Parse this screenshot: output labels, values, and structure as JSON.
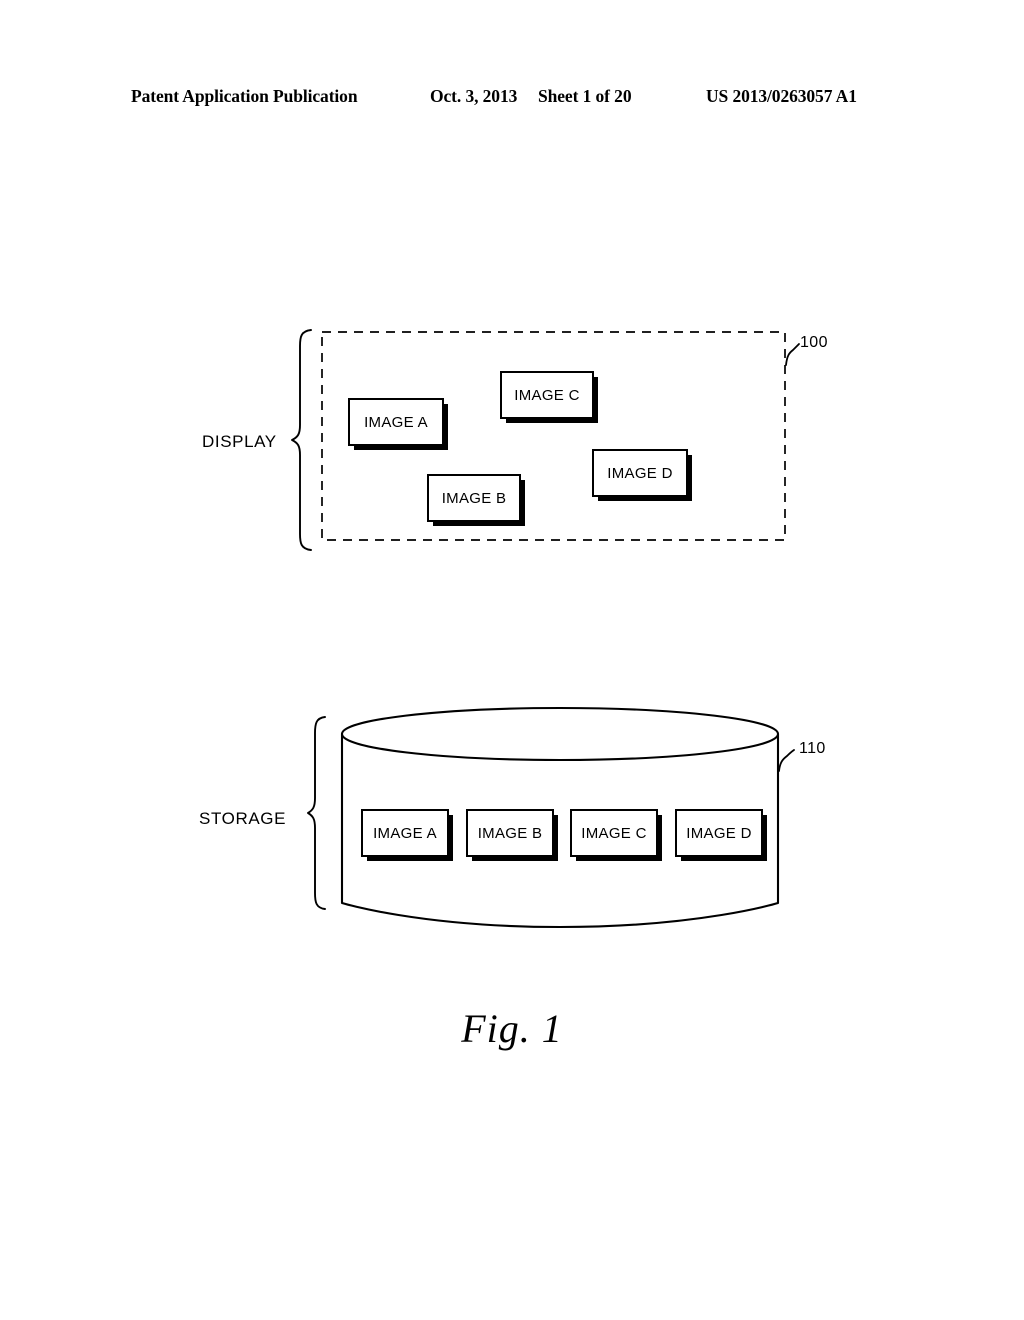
{
  "header": {
    "publication": "Patent Application Publication",
    "date": "Oct. 3, 2013",
    "sheet": "Sheet 1 of 20",
    "patent_number": "US 2013/0263057 A1"
  },
  "figure": {
    "caption": "Fig. 1",
    "display": {
      "label": "DISPLAY",
      "ref_numeral": "100",
      "boundary_style": "dashed-rectangle",
      "items": [
        {
          "label": "IMAGE A"
        },
        {
          "label": "IMAGE B"
        },
        {
          "label": "IMAGE C"
        },
        {
          "label": "IMAGE D"
        }
      ]
    },
    "storage": {
      "label": "STORAGE",
      "ref_numeral": "110",
      "boundary_style": "cylinder-database",
      "items": [
        {
          "label": "IMAGE A"
        },
        {
          "label": "IMAGE B"
        },
        {
          "label": "IMAGE C"
        },
        {
          "label": "IMAGE D"
        }
      ]
    }
  },
  "colors": {
    "ink": "#000000",
    "paper": "#ffffff"
  }
}
